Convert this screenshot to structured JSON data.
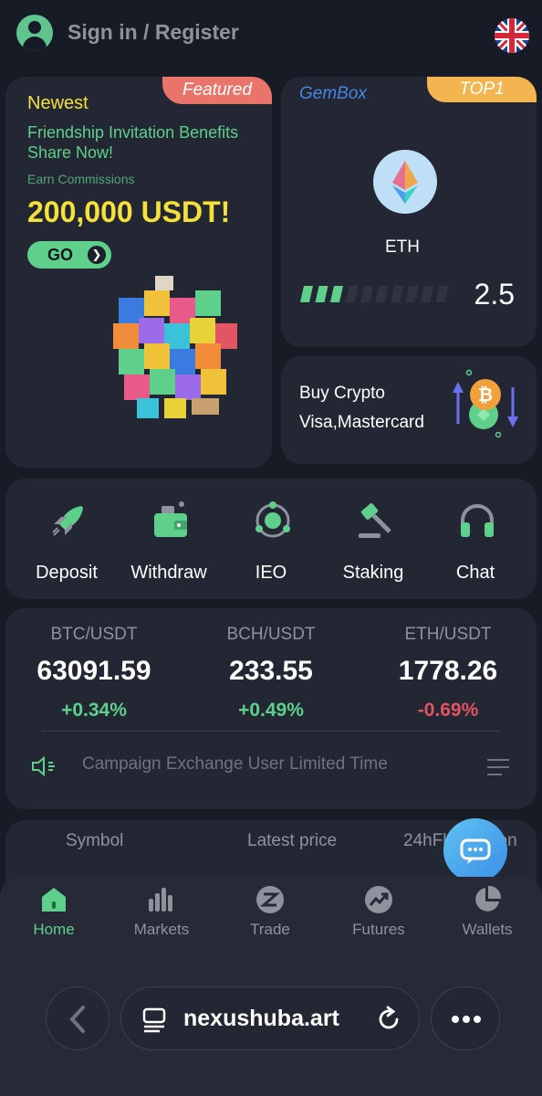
{
  "header": {
    "signin_label": "Sign in / Register",
    "avatar_icon": "user-avatar-icon",
    "flag_icon": "uk-flag-icon"
  },
  "featured": {
    "tag": "Featured",
    "newest": "Newest",
    "line1": "Friendship Invitation Benefits",
    "line2": "Share Now!",
    "earn": "Earn Commissions",
    "amount": "200,000 USDT!",
    "go_label": "GO"
  },
  "gembox": {
    "label": "GemBox",
    "tag": "TOP1",
    "coin": "ETH",
    "value": "2.5",
    "progress_filled": 3,
    "progress_total": 10
  },
  "buy": {
    "line1": "Buy Crypto",
    "line2": "Visa,Mastercard"
  },
  "actions": [
    {
      "label": "Deposit",
      "icon": "rocket-icon"
    },
    {
      "label": "Withdraw",
      "icon": "wallet-icon"
    },
    {
      "label": "IEO",
      "icon": "orbit-icon"
    },
    {
      "label": "Staking",
      "icon": "gavel-icon"
    },
    {
      "label": "Chat",
      "icon": "headset-icon"
    }
  ],
  "tickers": [
    {
      "pair": "BTC/USDT",
      "price": "63091.59",
      "change": "+0.34%"
    },
    {
      "pair": "BCH/USDT",
      "price": "233.55",
      "change": "+0.49%"
    },
    {
      "pair": "ETH/USDT",
      "price": "1778.26",
      "change": "-0.69%"
    }
  ],
  "announcement": "Campaign Exchange User Limited Time",
  "table": {
    "col_symbol": "Symbol",
    "col_price": "Latest price",
    "col_change": "24hFluctuation"
  },
  "nav": [
    {
      "label": "Home",
      "icon": "home-icon",
      "active": true
    },
    {
      "label": "Markets",
      "icon": "markets-icon",
      "active": false
    },
    {
      "label": "Trade",
      "icon": "trade-icon",
      "active": false
    },
    {
      "label": "Futures",
      "icon": "futures-icon",
      "active": false
    },
    {
      "label": "Wallets",
      "icon": "wallets-icon",
      "active": false
    }
  ],
  "browser": {
    "url": "nexushuba.art"
  },
  "colors": {
    "background": "#171b25",
    "card": "#232733",
    "accent_green": "#5fcf8c",
    "accent_red": "#e25563",
    "yellow": "#f6e13a",
    "featured_tag": "#e8746a",
    "top1_tag": "#f2b550"
  }
}
